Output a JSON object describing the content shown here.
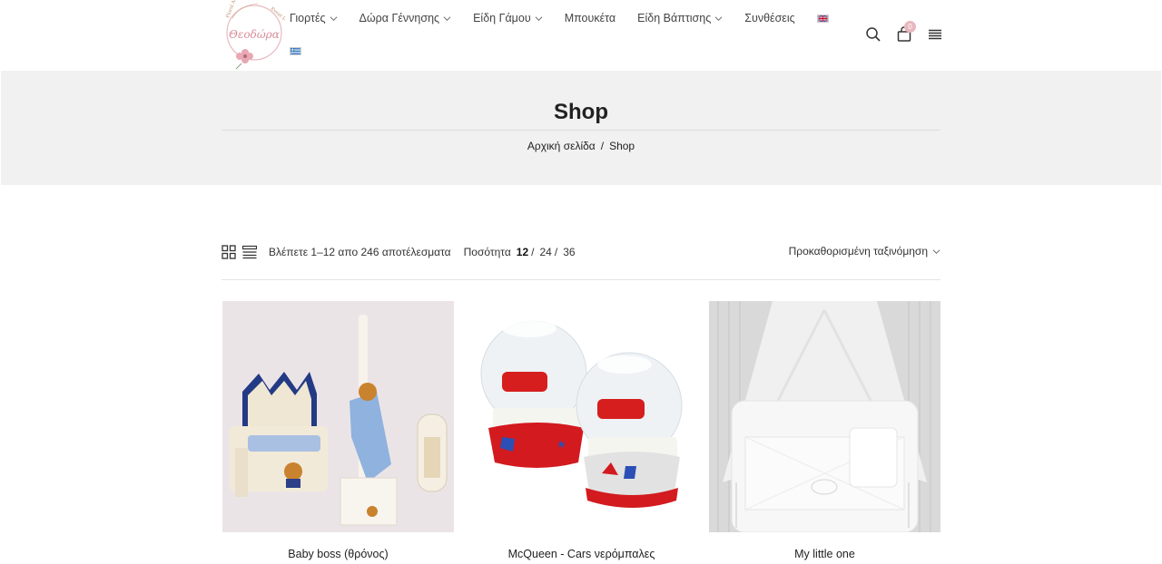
{
  "header": {
    "logo_text": "Θεοδώρα",
    "logo_tagline": "Floral Art & Event Design",
    "nav": [
      {
        "label": "Γιορτές",
        "has_dropdown": true
      },
      {
        "label": "Δώρα Γέννησης",
        "has_dropdown": true
      },
      {
        "label": "Είδη Γάμου",
        "has_dropdown": true
      },
      {
        "label": "Μπουκέτα",
        "has_dropdown": false
      },
      {
        "label": "Είδη Βάπτισης",
        "has_dropdown": true
      },
      {
        "label": "Συνθέσεις",
        "has_dropdown": false
      }
    ],
    "languages": [
      "en-flag-icon",
      "gr-flag-icon"
    ],
    "icons": [
      "search-icon",
      "cart-icon",
      "menu-icon"
    ],
    "cart_count": "0"
  },
  "page": {
    "title": "Shop",
    "breadcrumb": {
      "home": "Αρχική σελίδα",
      "separator": "/",
      "current": "Shop"
    }
  },
  "toolbar": {
    "results_text": "Βλέπετε 1–12 απο 246 αποτέλεσματα",
    "quantity_label": "Ποσότητα",
    "quantities": [
      "12",
      "24",
      "36"
    ],
    "active_quantity": "12",
    "sort_label": "Προκαθορισμένη ταξινόμηση"
  },
  "products": [
    {
      "title": "Baby boss (θρόνος)"
    },
    {
      "title": "McQueen - Cars νερόμπαλες"
    },
    {
      "title": "My little one"
    }
  ],
  "colors": {
    "accent_pink": "#e8b7be",
    "band_bg": "#f1f1f1"
  }
}
